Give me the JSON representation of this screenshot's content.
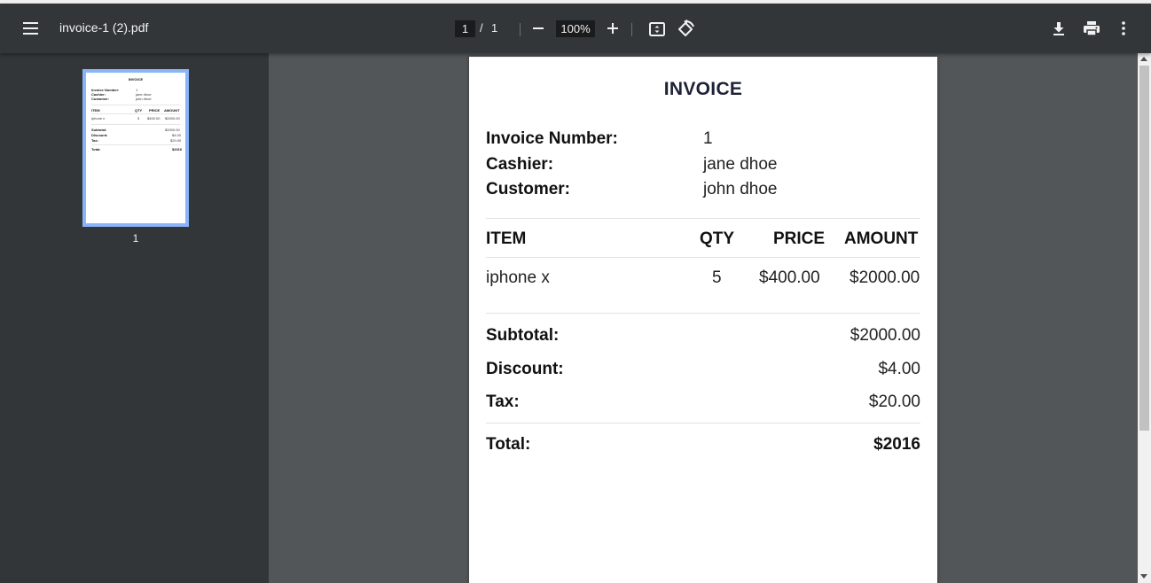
{
  "toolbar": {
    "menu_icon": "hamburger-menu-icon",
    "file_name": "invoice-1 (2).pdf",
    "page_current": "1",
    "page_separator": "/",
    "page_total": "1",
    "zoom": "100%",
    "icons": [
      "minus-icon",
      "plus-icon",
      "fit-to-page-icon",
      "rotate-icon",
      "download-icon",
      "print-icon",
      "more-vert-icon"
    ]
  },
  "sidebar": {
    "thumbnails": [
      {
        "page_number": "1"
      }
    ]
  },
  "document": {
    "title": "INVOICE",
    "meta": [
      {
        "label": "Invoice Number:",
        "value": "1"
      },
      {
        "label": "Cashier:",
        "value": "jane dhoe"
      },
      {
        "label": "Customer:",
        "value": "john dhoe"
      }
    ],
    "columns": {
      "item": "ITEM",
      "qty": "QTY",
      "price": "PRICE",
      "amount": "AMOUNT"
    },
    "rows": [
      {
        "item": "iphone x",
        "qty": "5",
        "price": "$400.00",
        "amount": "$2000.00"
      }
    ],
    "summary": {
      "subtotal_label": "Subtotal:",
      "subtotal_value": "$2000.00",
      "discount_label": "Discount:",
      "discount_value": "$4.00",
      "tax_label": "Tax:",
      "tax_value": "$20.00",
      "total_label": "Total:",
      "total_value": "$2016"
    }
  },
  "colors": {
    "toolbar_bg": "#323639",
    "viewer_bg": "#525659",
    "thumbnail_selected": "#8ab4f8",
    "title_text": "#1d2236"
  }
}
